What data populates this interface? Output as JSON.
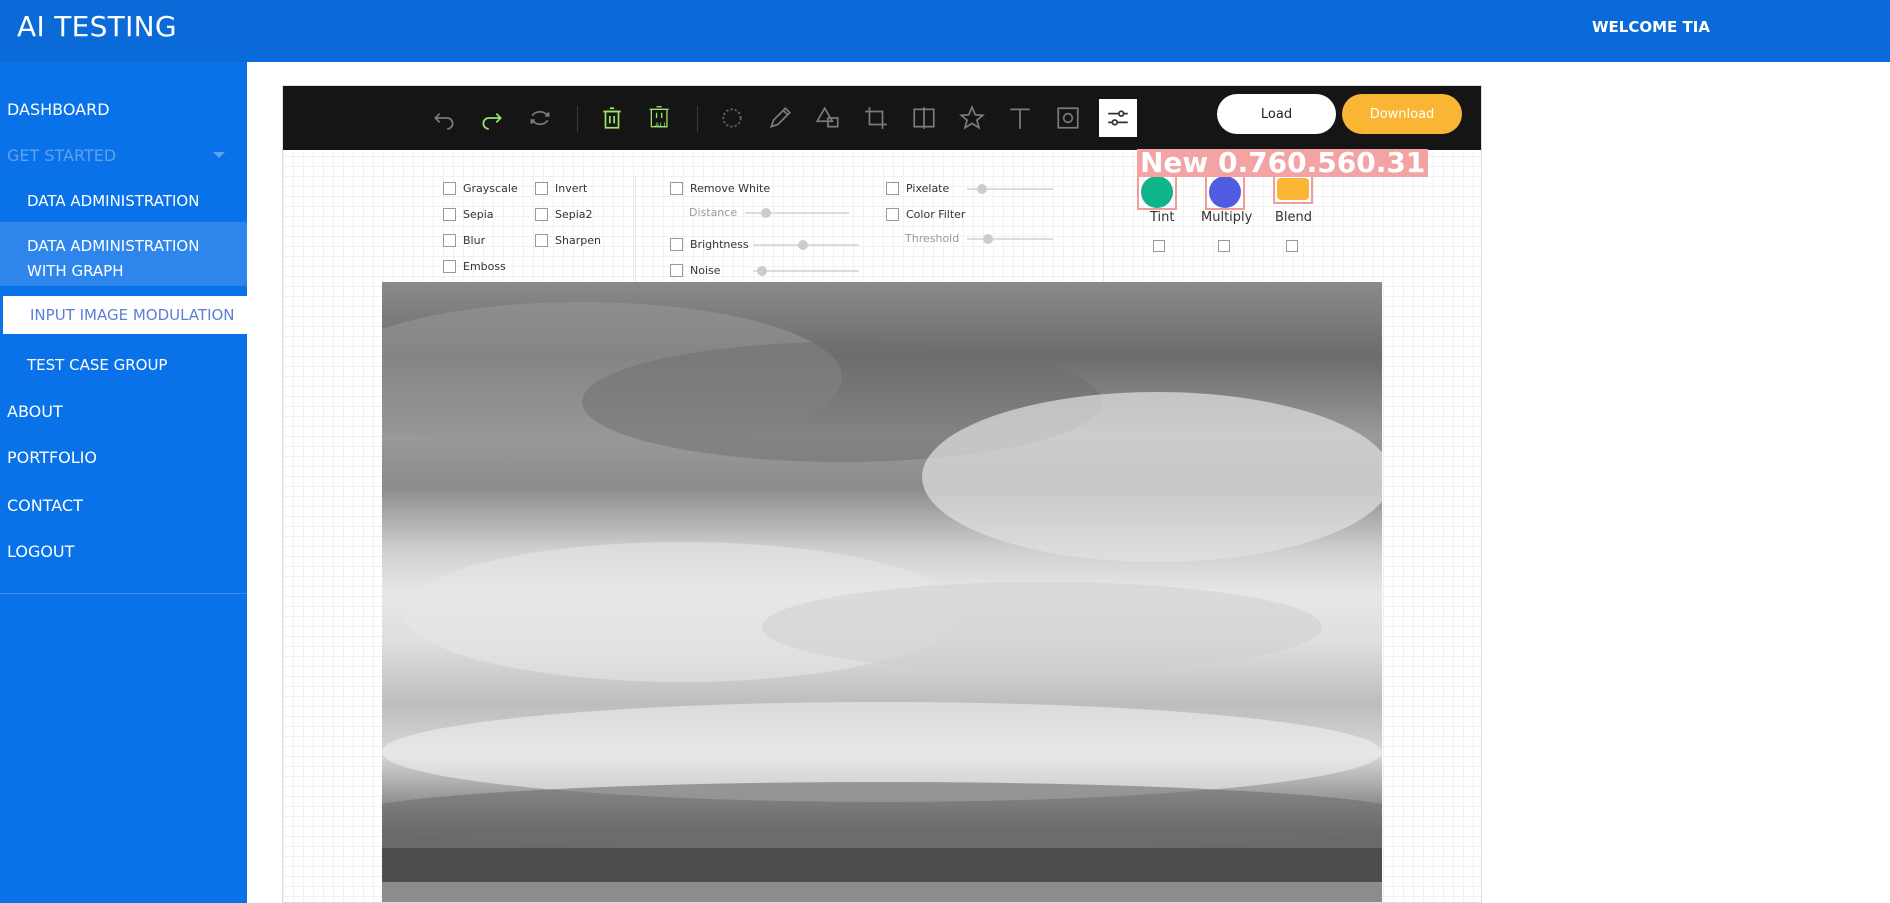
{
  "header": {
    "app_title": "AI TESTING",
    "welcome": "WELCOME TIA"
  },
  "sidebar": {
    "items": [
      {
        "label": "DASHBOARD"
      },
      {
        "label": "GET STARTED",
        "state": "disabled"
      },
      {
        "label": "DATA ADMINISTRATION"
      },
      {
        "label": "DATA ADMINISTRATION WITH GRAPH",
        "state": "highlighted"
      },
      {
        "label": "INPUT IMAGE MODULATION",
        "state": "active"
      },
      {
        "label": "TEST CASE GROUP"
      },
      {
        "label": "ABOUT"
      },
      {
        "label": "PORTFOLIO"
      },
      {
        "label": "CONTACT"
      },
      {
        "label": "LOGOUT"
      }
    ]
  },
  "toolbar": {
    "icons": [
      "undo-icon",
      "redo-icon",
      "reset-icon",
      "delete-icon",
      "delete-all-icon",
      "rotate-icon",
      "draw-icon",
      "shape-icon",
      "crop-icon",
      "flip-icon",
      "icon-tool-icon",
      "text-icon",
      "mask-icon",
      "filter-icon"
    ],
    "delete_all_caption": "ALL",
    "load_label": "Load",
    "download_label": "Download",
    "accent": "#fbb534"
  },
  "filters": {
    "grayscale": "Grayscale",
    "invert": "Invert",
    "sepia": "Sepia",
    "sepia2": "Sepia2",
    "blur": "Blur",
    "sharpen": "Sharpen",
    "emboss": "Emboss",
    "remove_white": "Remove White",
    "distance": "Distance",
    "brightness": "Brightness",
    "noise": "Noise",
    "pixelate": "Pixelate",
    "color_filter": "Color Filter",
    "threshold": "Threshold",
    "tint": "Tint",
    "multiply": "Multiply",
    "blend": "Blend",
    "tint_color": "#10b48a",
    "multiply_color": "#4f5ce0",
    "blend_color": "#fbb534"
  },
  "overlay_text": "New 0.760.560.31"
}
